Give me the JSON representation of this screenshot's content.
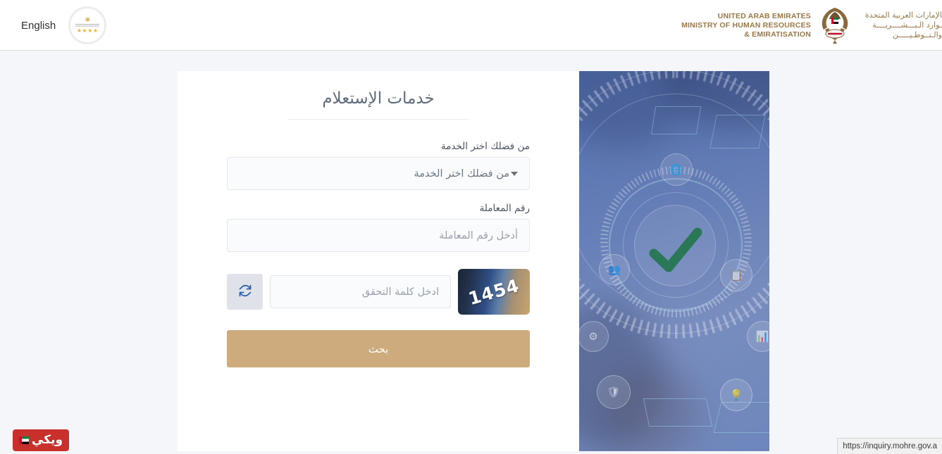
{
  "header": {
    "language_link": "English",
    "badge": {
      "stars": "★★★★",
      "name": "uae-government-service-badge"
    },
    "ministry_en_lines": [
      "UNITED ARAB EMIRATES",
      "MINISTRY OF HUMAN RESOURCES",
      "& EMIRATISATION"
    ],
    "ministry_ar_lines": [
      "الإمارات العربية المتحدة",
      "ـوارد الـبـــشــــريــــة",
      "والـتــوطـيـــــن"
    ],
    "emblem": "uae-falcon-emblem"
  },
  "form": {
    "title": "خدمات الإستعلام",
    "service": {
      "label": "من فضلك اختر الخدمة",
      "selected": "من فضلك اختر الخدمة"
    },
    "transaction": {
      "label": "رقم المعاملة",
      "placeholder": "أدخل رقم المعاملة",
      "value": ""
    },
    "captcha": {
      "placeholder": "ادخل كلمة التحقق",
      "value": "",
      "code": "1454",
      "refresh_icon": "refresh-icon"
    },
    "submit_label": "بحث"
  },
  "hero": {
    "alt": "digital-services-checkmark-illustration",
    "check_color": "#1f7a43",
    "icons": [
      "globe-icon",
      "people-icon",
      "clipboard-icon",
      "gear-icon",
      "shield-check-icon",
      "lightbulb-icon",
      "chart-icon"
    ]
  },
  "watermark": {
    "text": "ويكي",
    "flag": "uae-flag"
  },
  "statusbar": {
    "url": "https://inquiry.mohre.gov.a"
  },
  "colors": {
    "accent_gold": "#cdab7d",
    "ministry_brown": "#9a7846",
    "page_bg": "#f5f6f9",
    "card_bg": "#ffffff",
    "watermark_red": "#c8302c"
  }
}
